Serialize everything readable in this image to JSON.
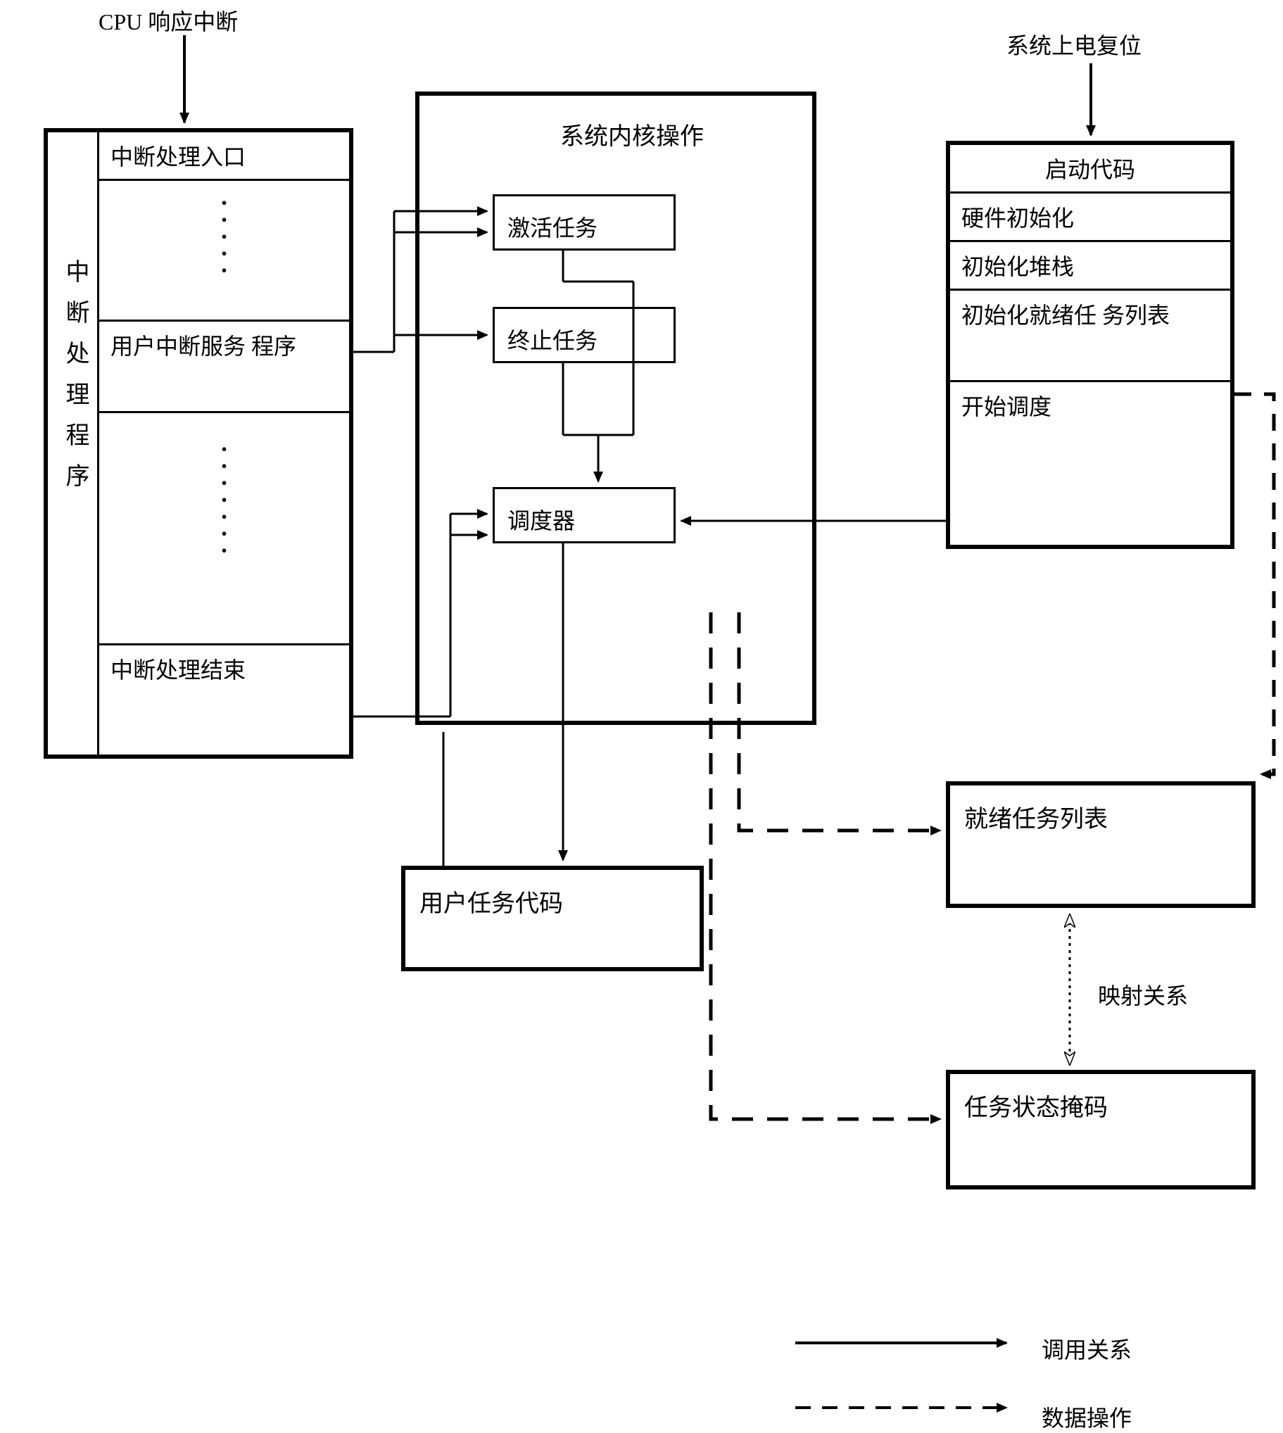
{
  "top_labels": {
    "cpu": "CPU 响应中断",
    "power": "系统上电复位"
  },
  "isr": {
    "side_title": "中断处理程序",
    "entry": "中断处理入口",
    "user_isr": "用户中断服务\n程序",
    "end": "中断处理结束"
  },
  "kernel": {
    "title": "系统内核操作",
    "activate": "激活任务",
    "terminate": "终止任务",
    "scheduler": "调度器"
  },
  "startup": {
    "boot": "启动代码",
    "hw_init": "硬件初始化",
    "stack_init": "初始化堆栈",
    "ready_init": "初始化就绪任\n务列表",
    "begin_sched": "开始调度"
  },
  "user_task": "用户任务代码",
  "ready_list": "就绪任务列表",
  "mask": "任务状态掩码",
  "mapping": "映射关系",
  "legend": {
    "call": "调用关系",
    "data": "数据操作"
  }
}
